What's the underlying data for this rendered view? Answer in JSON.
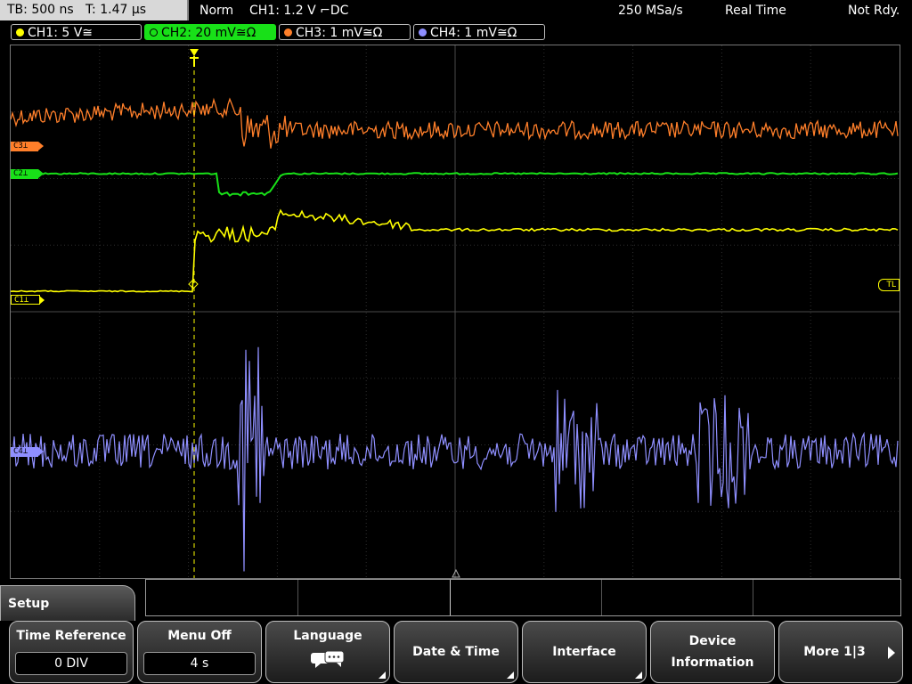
{
  "status": {
    "timebase": "TB: 500 ns",
    "time_pos": "T: 1.47 µs",
    "mode": "Norm",
    "trigger": "CH1: 1.2 V ⌐DC",
    "sample_rate": "250 MSa/s",
    "acq": "Real Time",
    "state": "Not Rdy."
  },
  "channels": [
    {
      "label": "CH1: 5 V≅",
      "color": "#ffff00",
      "screen_label": "C1⊥"
    },
    {
      "label": "CH2: 20 mV≅Ω",
      "color": "#18e018",
      "screen_label": "C2⊥"
    },
    {
      "label": "CH3: 1 mV≅Ω",
      "color": "#ff7f2a",
      "screen_label": "C3⊥"
    },
    {
      "label": "CH4: 1 mV≅Ω",
      "color": "#8f8fff",
      "screen_label": "C4⊥"
    }
  ],
  "trigger_level_marker": "TL",
  "trigger_marker": "T",
  "menu": {
    "title": "Setup",
    "keys": [
      {
        "label": "Time Reference",
        "value": "0 DIV"
      },
      {
        "label": "Menu Off",
        "value": "4 s"
      },
      {
        "label": "Language",
        "icon": "speech-bubbles-icon"
      },
      {
        "label": "Date & Time"
      },
      {
        "label": "Interface"
      },
      {
        "label1": "Device",
        "label2": "Information"
      },
      {
        "label": "More 1|3"
      }
    ]
  }
}
